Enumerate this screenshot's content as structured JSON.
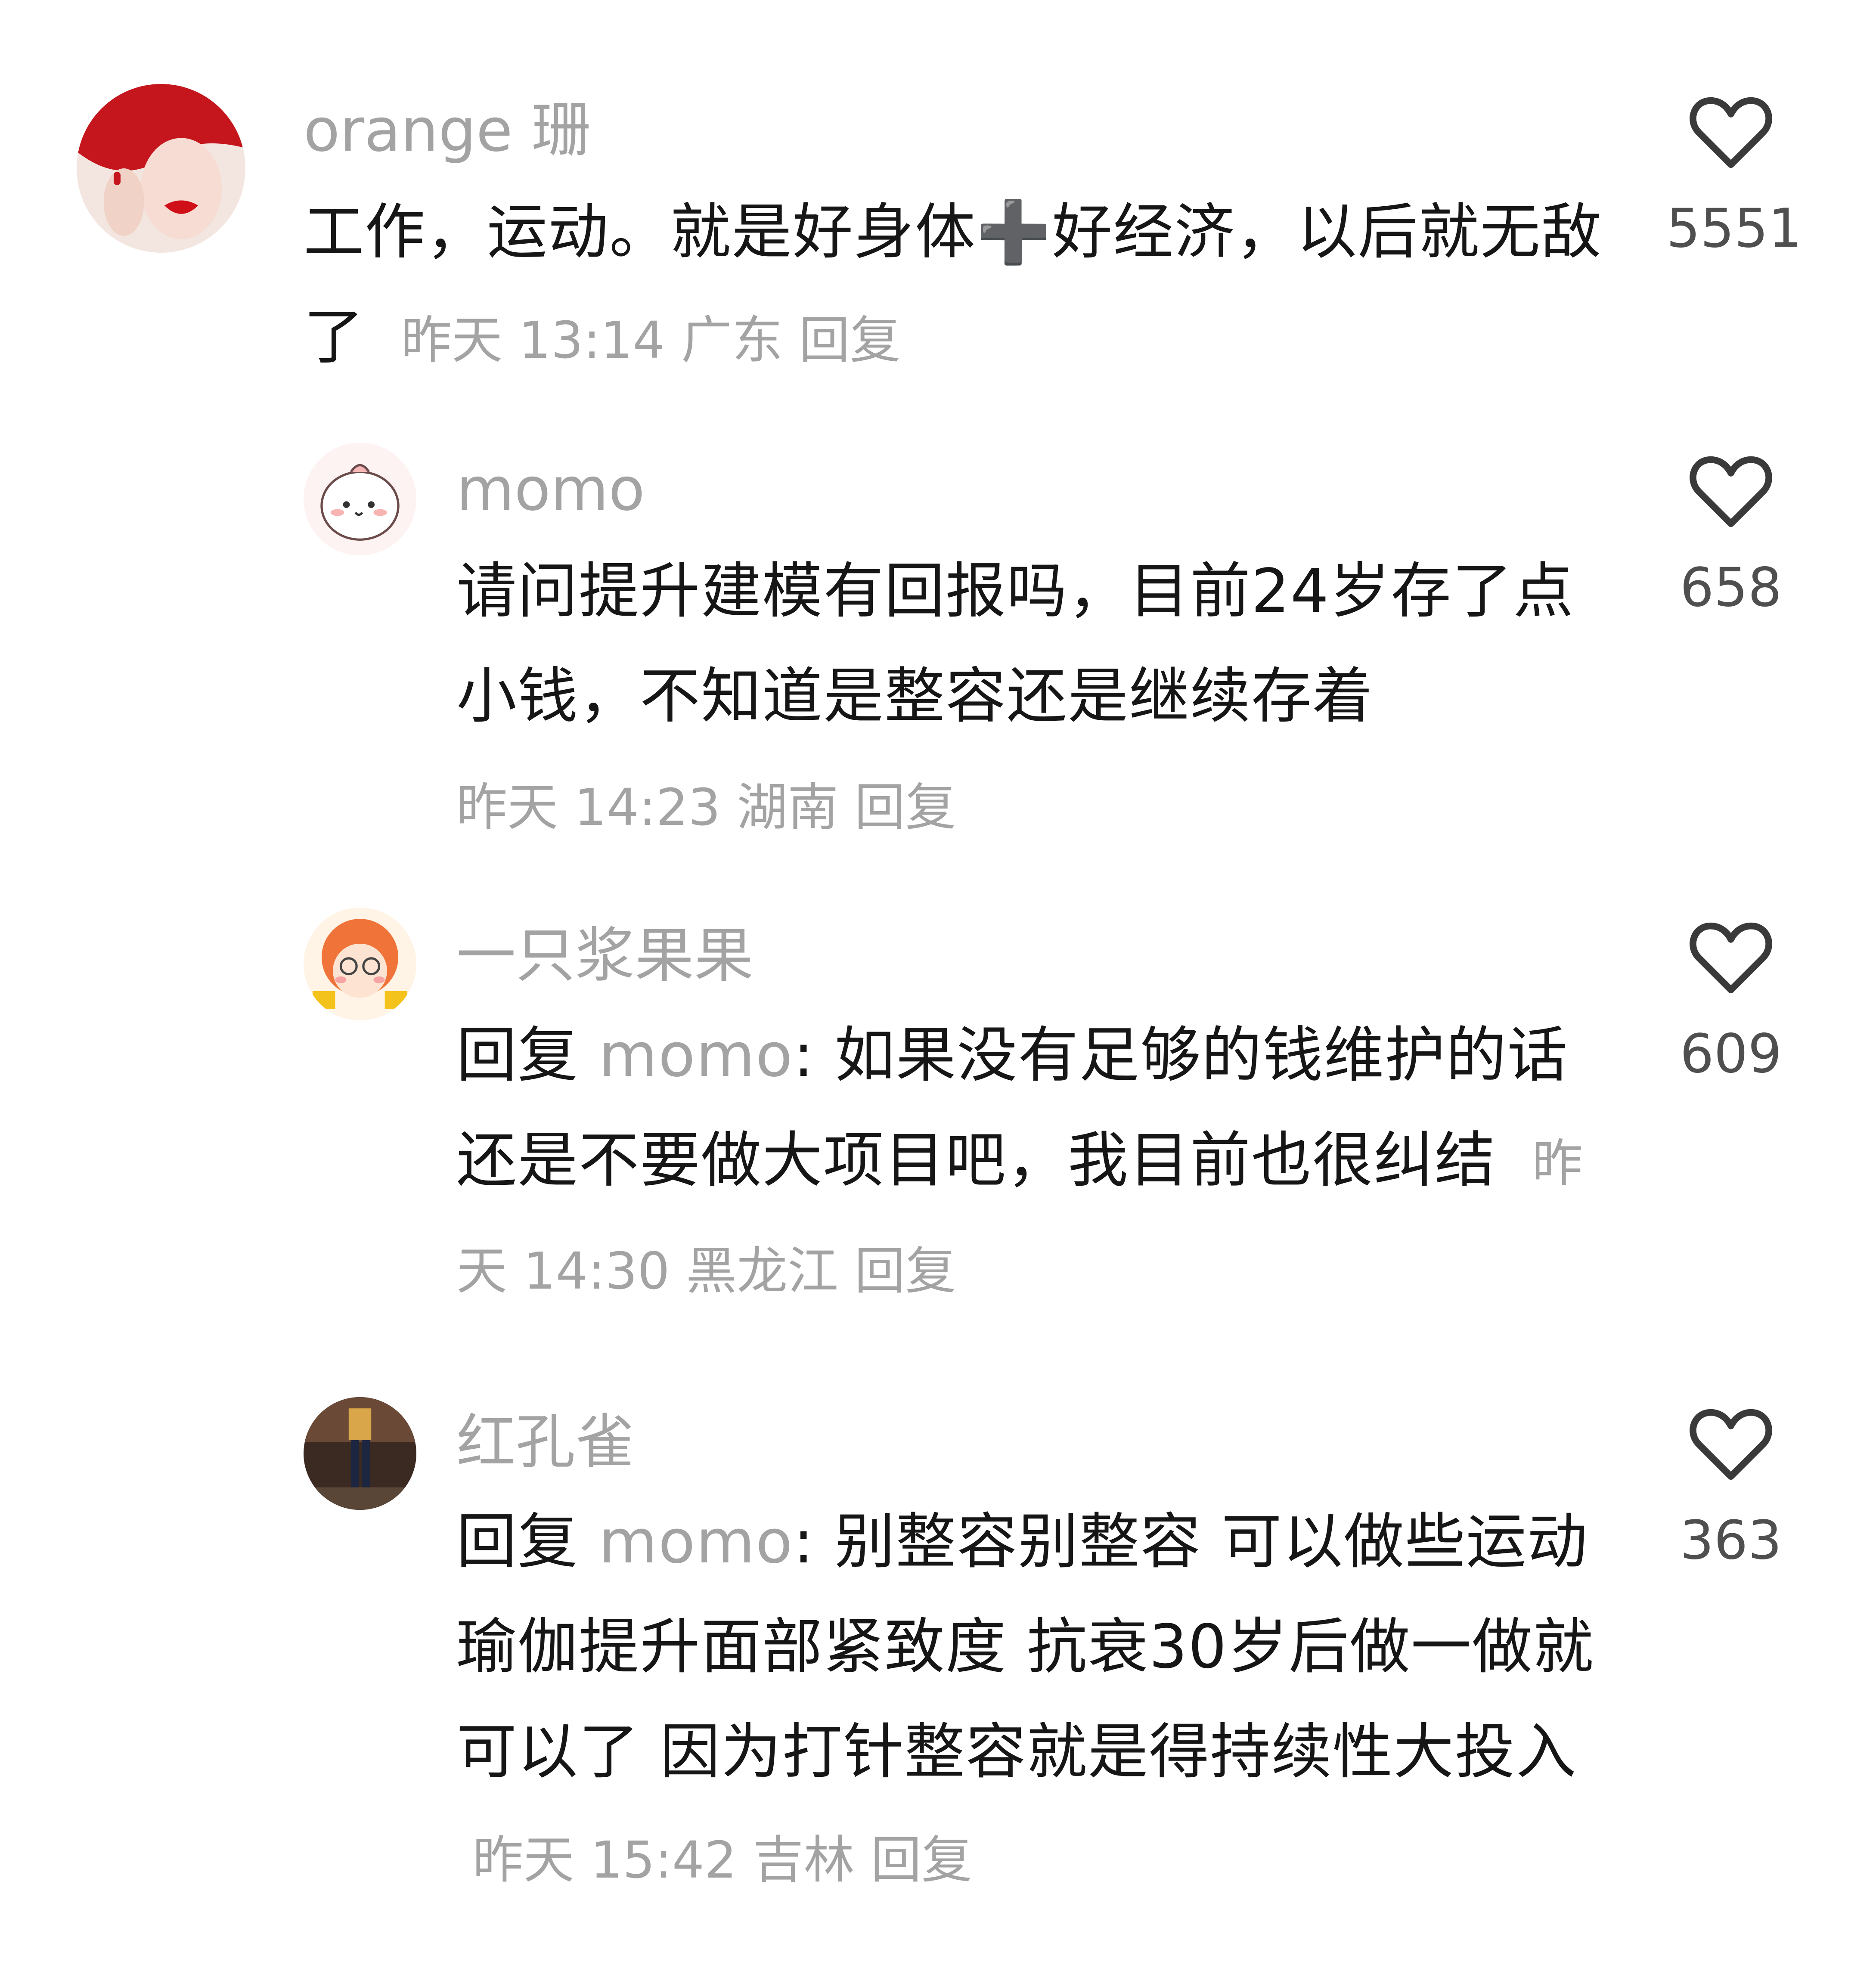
{
  "comments": [
    {
      "username": "orange 珊",
      "text": "工作，运动。就是好身体➕好经济，以后就无敌了",
      "reply_prefix": "",
      "reply_target": "",
      "time": "昨天 13:14",
      "location": "广东",
      "reply_label": "回复",
      "likes": "5551"
    },
    {
      "username": "momo",
      "text": "请问提升建模有回报吗，目前24岁存了点小钱，不知道是整容还是继续存着",
      "reply_prefix": "",
      "reply_target": "",
      "time": "昨天 14:23",
      "location": "湖南",
      "reply_label": "回复",
      "likes": "658"
    },
    {
      "username": "一只浆果果",
      "text": "如果没有足够的钱维护的话还是不要做大项目吧，我目前也很纠结",
      "reply_prefix": "回复",
      "reply_target": "momo",
      "time": "昨天 14:30",
      "location": "黑龙江",
      "reply_label": "回复",
      "likes": "609"
    },
    {
      "username": "红孔雀",
      "text": "别整容别整容 可以做些运动瑜伽提升面部紧致度 抗衰30岁后做一做就可以了 因为打针整容就是得持续性大投入",
      "reply_prefix": "回复",
      "reply_target": "momo",
      "time": "昨天 15:42",
      "location": "吉林",
      "reply_label": "回复",
      "likes": "363"
    }
  ],
  "icons": {
    "like": "heart-outline-icon"
  },
  "colors": {
    "text": "#161616",
    "muted": "#a3a3a3",
    "count": "#4f4f4f"
  }
}
